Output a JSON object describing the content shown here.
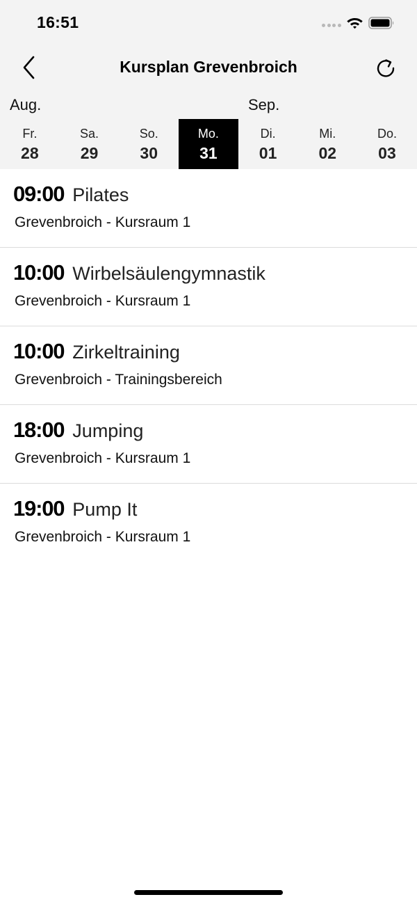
{
  "status_bar": {
    "time": "16:51",
    "icons": [
      "signal-dots-icon",
      "wifi-icon",
      "battery-icon"
    ]
  },
  "nav": {
    "title": "Kursplan Grevenbroich",
    "back_icon": "chevron-left-icon",
    "refresh_icon": "refresh-icon"
  },
  "months": [
    {
      "label": "Aug."
    },
    {
      "label": "Sep."
    }
  ],
  "days": [
    {
      "name": "Fr.",
      "num": "28",
      "selected": false
    },
    {
      "name": "Sa.",
      "num": "29",
      "selected": false
    },
    {
      "name": "So.",
      "num": "30",
      "selected": false
    },
    {
      "name": "Mo.",
      "num": "31",
      "selected": true
    },
    {
      "name": "Di.",
      "num": "01",
      "selected": false
    },
    {
      "name": "Mi.",
      "num": "02",
      "selected": false
    },
    {
      "name": "Do.",
      "num": "03",
      "selected": false
    }
  ],
  "courses": [
    {
      "time": "09:00",
      "name": "Pilates",
      "location": "Grevenbroich - Kursraum 1"
    },
    {
      "time": "10:00",
      "name": "Wirbelsäulengymnastik",
      "location": "Grevenbroich - Kursraum 1"
    },
    {
      "time": "10:00",
      "name": "Zirkeltraining",
      "location": "Grevenbroich - Trainingsbereich"
    },
    {
      "time": "18:00",
      "name": "Jumping",
      "location": "Grevenbroich - Kursraum 1"
    },
    {
      "time": "19:00",
      "name": "Pump It",
      "location": "Grevenbroich - Kursraum 1"
    }
  ],
  "colors": {
    "header_bg": "#f3f3f3",
    "selected_day_bg": "#000000",
    "selected_day_text": "#ffffff",
    "divider": "#dcdcdc"
  }
}
